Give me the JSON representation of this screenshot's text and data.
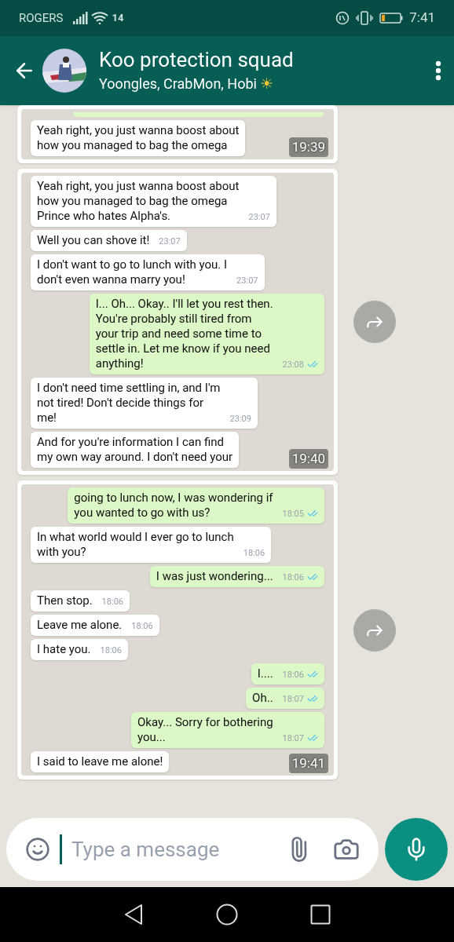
{
  "status_bar": {
    "carrier": "ROGERS",
    "network": "14",
    "time": "7:41"
  },
  "header": {
    "title": "Koo protection squad",
    "subtitle": "Yoongles, CrabMon, Hobi",
    "emoji": "☀"
  },
  "messages": [
    {
      "kind": "image",
      "time": "19:39",
      "screenshot": [
        {
          "kind": "cut",
          "outgoing": true
        },
        {
          "kind": "bubble",
          "outgoing": false,
          "text": "Yeah right, you just wanna boost about\nhow you managed to bag the omega"
        }
      ]
    },
    {
      "kind": "image",
      "time": "19:40",
      "forward": true,
      "screenshot": [
        {
          "kind": "bubble",
          "outgoing": false,
          "text": "Yeah right, you just wanna boost about\nhow you managed to bag the omega\nPrince who hates Alpha's.",
          "time": "23:07"
        },
        {
          "kind": "bubble",
          "outgoing": false,
          "text": "Well you can shove it!",
          "time": "23:07"
        },
        {
          "kind": "bubble",
          "outgoing": false,
          "text": "I don't want to go to lunch with you. I\ndon't even wanna marry you!",
          "time": "23:07"
        },
        {
          "kind": "bubble",
          "outgoing": true,
          "text": "I... Oh... Okay.. I'll let you rest then.\nYou're probably still tired from\nyour trip and need some time to\nsettle in. Let me know if you need\nanything!",
          "time": "23:08",
          "read": true
        },
        {
          "kind": "bubble",
          "outgoing": false,
          "text": "I don't need time settling in, and I'm\nnot tired! Don't decide things for\nme!",
          "time": "23:09"
        },
        {
          "kind": "bubble",
          "outgoing": false,
          "text": "And for you're information I can find\nmy own way around. I don't need your"
        }
      ]
    },
    {
      "kind": "image",
      "time": "19:41",
      "forward": true,
      "screenshot": [
        {
          "kind": "bubble",
          "outgoing": true,
          "text": "going to lunch now, I was wondering if\nyou wanted to go with us?",
          "time": "18:05",
          "read": true
        },
        {
          "kind": "bubble",
          "outgoing": false,
          "text": "In what world would I ever go to lunch\nwith you?",
          "time": "18:06"
        },
        {
          "kind": "bubble",
          "outgoing": true,
          "text": "I was just wondering...",
          "time": "18:06",
          "read": true
        },
        {
          "kind": "bubble",
          "outgoing": false,
          "text": "Then stop.",
          "time": "18:06"
        },
        {
          "kind": "bubble",
          "outgoing": false,
          "text": "Leave me alone.",
          "time": "18:06"
        },
        {
          "kind": "bubble",
          "outgoing": false,
          "text": "I hate you.",
          "time": "18:06"
        },
        {
          "kind": "bubble",
          "outgoing": true,
          "text": "I....",
          "time": "18:06",
          "read": true
        },
        {
          "kind": "bubble",
          "outgoing": true,
          "text": "Oh..",
          "time": "18:07",
          "read": true
        },
        {
          "kind": "bubble",
          "outgoing": true,
          "text": "Okay... Sorry for bothering\nyou...",
          "time": "18:07",
          "read": true
        },
        {
          "kind": "bubble",
          "outgoing": false,
          "text": "I said to leave me alone!"
        }
      ]
    }
  ],
  "composer": {
    "placeholder": "Type a message"
  }
}
